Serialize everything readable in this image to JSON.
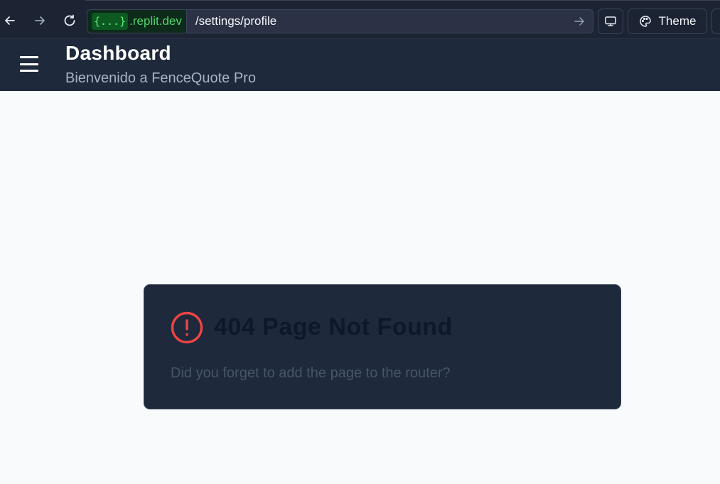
{
  "browser": {
    "url_badge": "{...}",
    "url_host": ".replit.dev",
    "url_path": "/settings/profile",
    "theme_label": "Theme",
    "icons": [
      "back-arrow-icon",
      "forward-arrow-icon",
      "reload-icon",
      "go-arrow-icon",
      "monitor-icon",
      "palette-icon"
    ]
  },
  "header": {
    "title": "Dashboard",
    "subtitle": "Bienvenido a FenceQuote Pro",
    "menu_icon": "hamburger-menu-icon"
  },
  "error_card": {
    "title": "404 Page Not Found",
    "message": "Did you forget to add the page to the router?",
    "icon": "alert-circle-icon",
    "icon_color": "#ef4444"
  },
  "colors": {
    "header_bg": "#1e293b",
    "page_bg": "#f8fafc",
    "url_host": "#4fd66b"
  }
}
